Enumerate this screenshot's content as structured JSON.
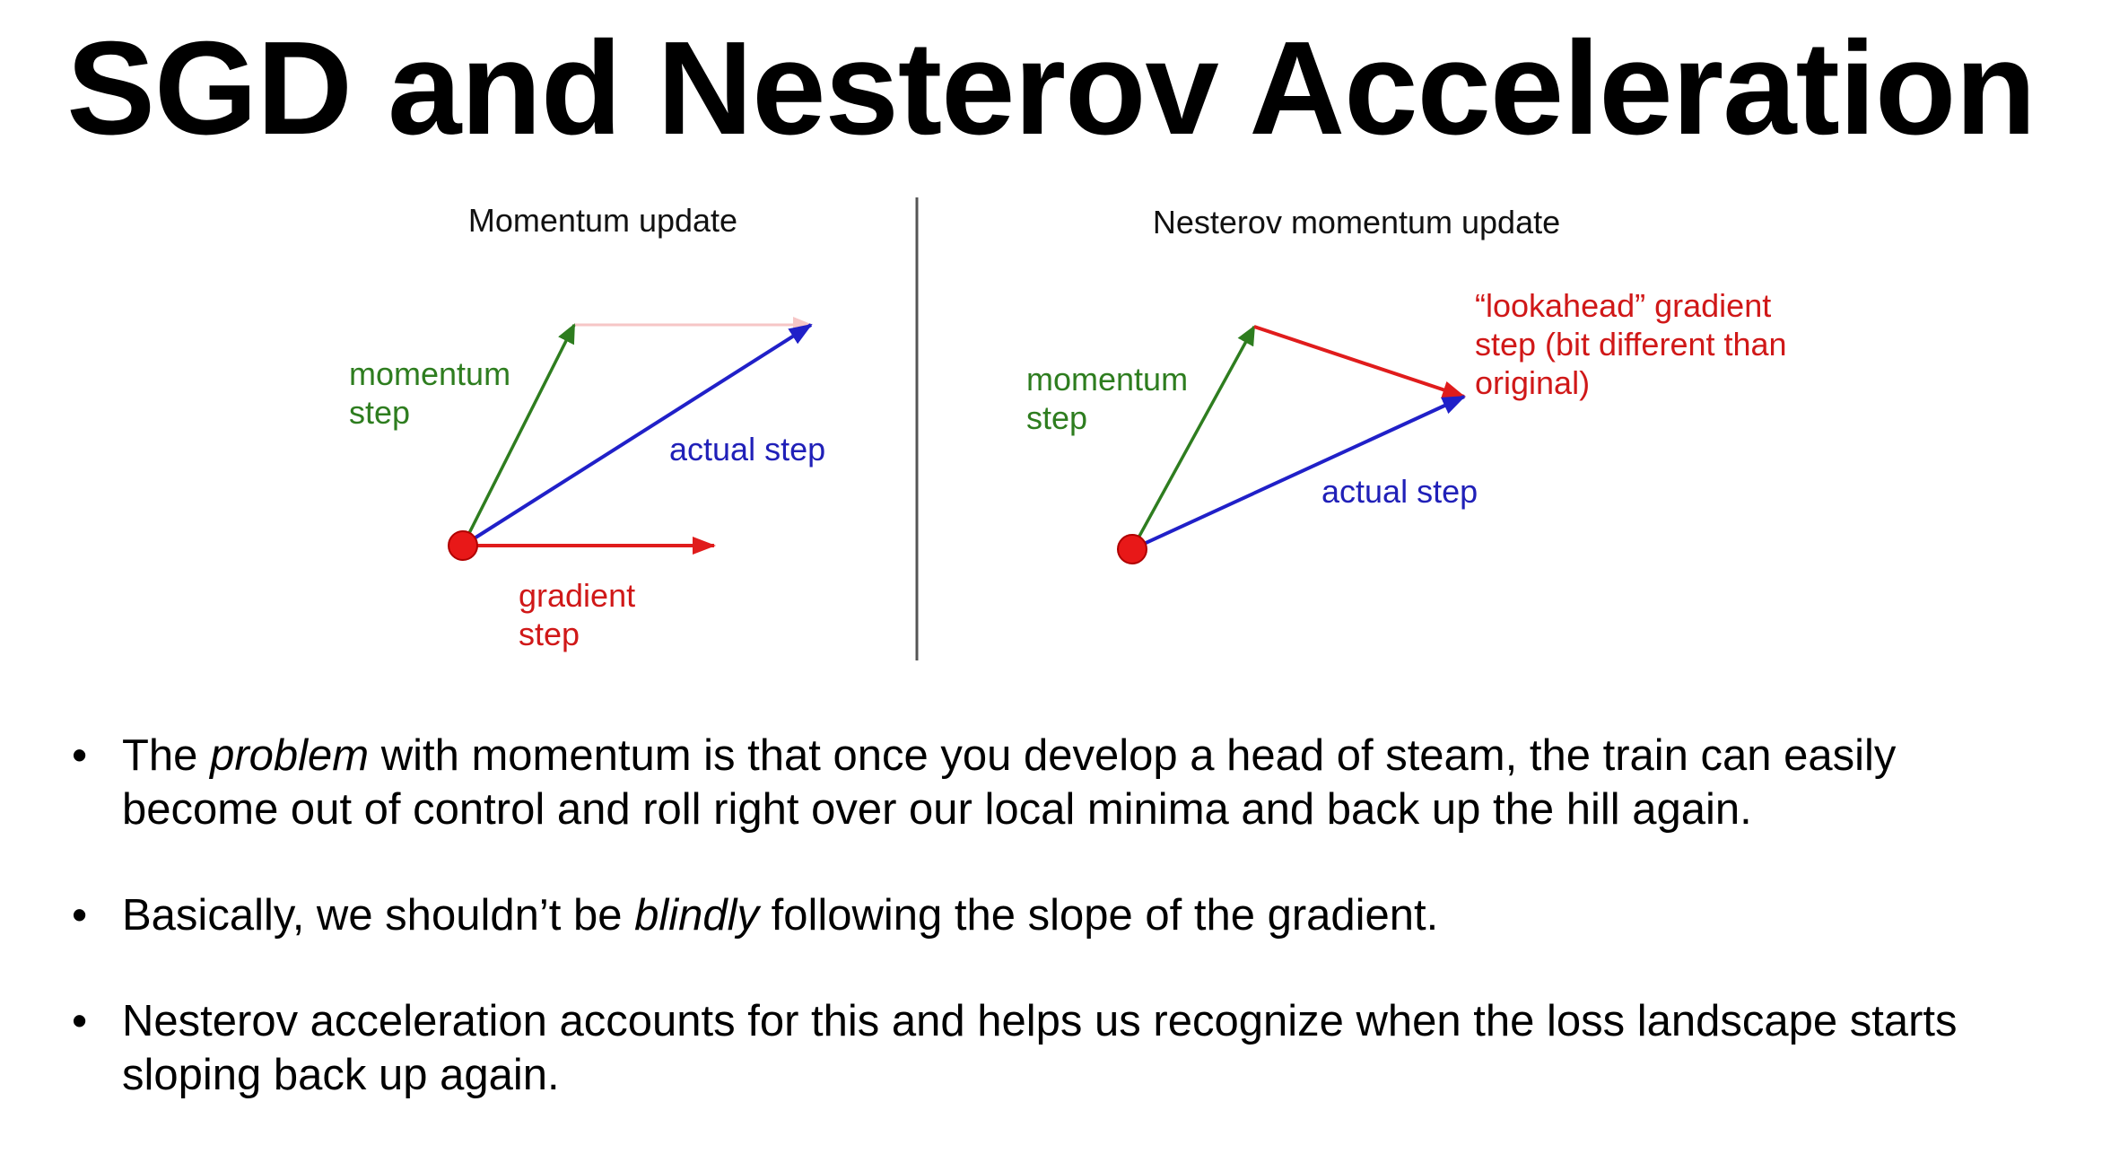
{
  "title": "SGD and Nesterov Acceleration",
  "diagram": {
    "left_panel": {
      "title": "Momentum update",
      "momentum_label": [
        "momentum",
        "step"
      ],
      "actual_label": "actual step",
      "gradient_label": [
        "gradient",
        "step"
      ]
    },
    "right_panel": {
      "title": "Nesterov momentum update",
      "momentum_label": [
        "momentum",
        "step"
      ],
      "lookahead_label": [
        "“lookahead” gradient",
        "step (bit different than",
        "original)"
      ],
      "actual_label": "actual step"
    },
    "colors": {
      "momentum": "#2e7d1f",
      "actual": "#2020c8",
      "gradient": "#e01c1c",
      "point": "#e81818",
      "divider": "#555555"
    }
  },
  "bullets": [
    {
      "parts": [
        "The ",
        "problem",
        " with momentum is that once you develop a head of steam, the train can easily become out of control and roll right over our local minima and back up the hill again."
      ]
    },
    {
      "parts": [
        "Basically, we shouldn’t be ",
        "blindly",
        " following the slope of the gradient."
      ]
    },
    {
      "parts": [
        "Nesterov acceleration accounts for this and helps us recognize when the loss landscape starts sloping back up again."
      ]
    }
  ],
  "bullet_symbol": "•"
}
